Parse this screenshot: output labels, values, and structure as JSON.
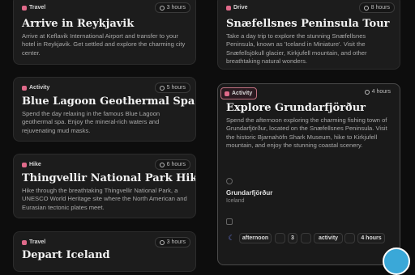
{
  "cards": [
    {
      "tag": "Travel",
      "tag_color": "#e06a8a",
      "duration": "3 hours",
      "title": "Arrive in Reykjavik",
      "desc": "Arrive at Keflavik International Airport and transfer to your hotel in Reykjavik. Get settled and explore the charming city center."
    },
    {
      "tag": "Activity",
      "tag_color": "#e06a8a",
      "duration": "5 hours",
      "title": "Blue Lagoon Geothermal Spa",
      "desc": "Spend the day relaxing in the famous Blue Lagoon geothermal spa. Enjoy the mineral-rich waters and rejuvenating mud masks."
    },
    {
      "tag": "Hike",
      "tag_color": "#e06a8a",
      "duration": "6 hours",
      "title": "Thingvellir National Park Hike",
      "desc": "Hike through the breathtaking Thingvellir National Park, a UNESCO World Heritage site where the North American and Eurasian tectonic plates meet."
    },
    {
      "tag": "Travel",
      "tag_color": "#e06a8a",
      "duration": "3 hours",
      "title": "Depart Iceland",
      "desc": ""
    },
    {
      "tag": "Drive",
      "tag_color": "#e06a8a",
      "duration": "8 hours",
      "title": "Snæfellsnes Peninsula Tour",
      "desc": "Take a day trip to explore the stunning Snæfellsnes Peninsula, known as 'Iceland in Miniature'. Visit the Snæfellsjökull glacier, Kirkjufell mountain, and other breathtaking natural wonders."
    },
    {
      "tag": "Activity",
      "tag_color": "#e06a8a",
      "duration": "4 hours",
      "title": "Explore Grundarfjörður",
      "desc": "Spend the afternoon exploring the charming fishing town of Grundarfjörður, located on the Snæfellsnes Peninsula. Visit the historic Bjarnahöfn Shark Museum, hike to Kirkjufell mountain, and enjoy the stunning coastal scenery."
    }
  ],
  "detail": {
    "location_name": "Grundarfjörður",
    "location_country": "Iceland",
    "time_of_day": "afternoon",
    "day": "3",
    "category": "activity",
    "duration": "4 hours"
  }
}
